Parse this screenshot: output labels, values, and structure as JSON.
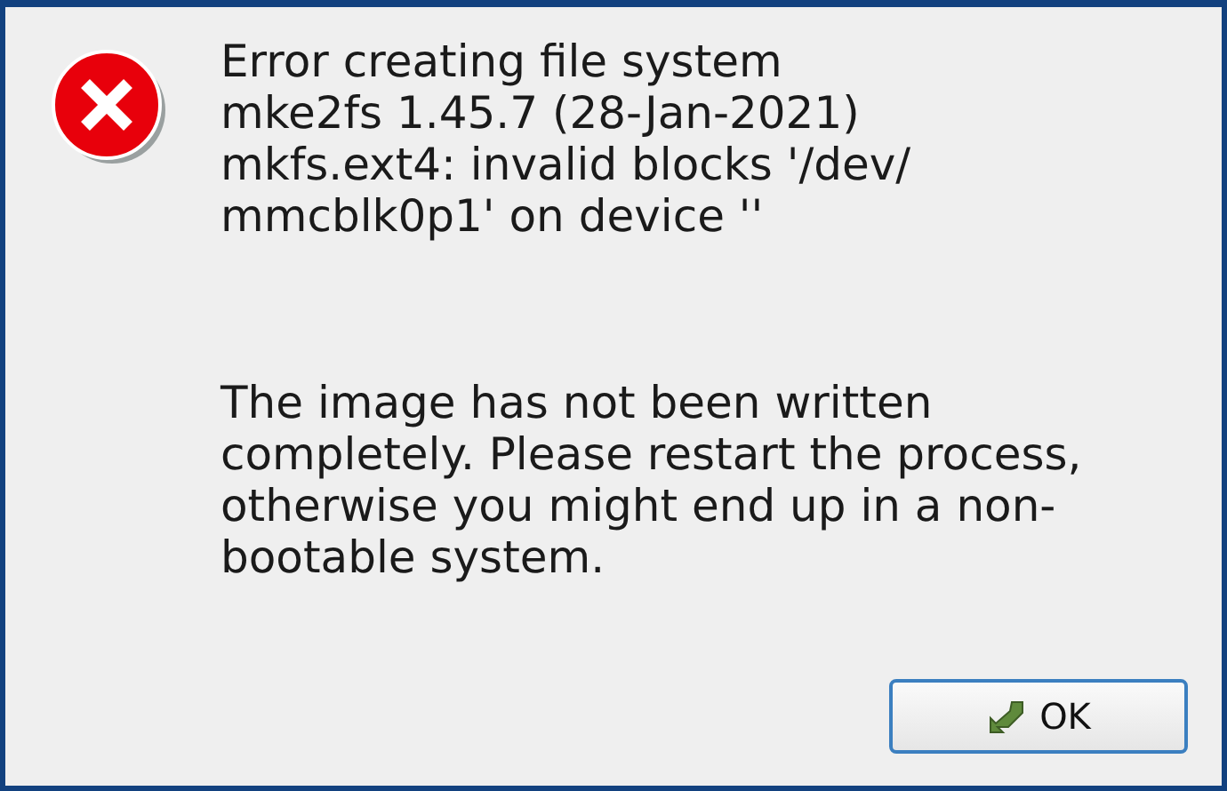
{
  "dialog": {
    "kind": "error",
    "message_lines": [
      "Error creating file system",
      "mke2fs 1.45.7 (28-Jan-2021)",
      "mkfs.ext4: invalid blocks '/dev/",
      "mmcblk0p1' on device ''"
    ],
    "detail_lines": [
      "The image has not been written",
      "completely. Please restart the process,",
      "otherwise you might end up in a non-",
      "bootable system."
    ],
    "buttons": [
      {
        "label": "OK",
        "default": true
      }
    ]
  }
}
